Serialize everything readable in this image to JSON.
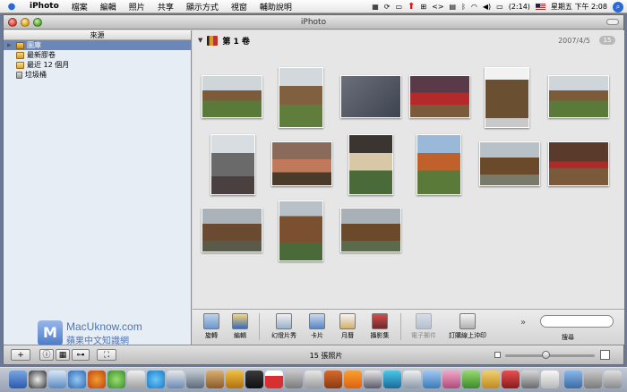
{
  "menubar": {
    "app_name": "iPhoto",
    "menus": [
      "檔案",
      "編輯",
      "照片",
      "共享",
      "顯示方式",
      "視窗",
      "輔助說明"
    ],
    "battery": "(2:14)",
    "clock": "星期五 下午 2:08"
  },
  "window": {
    "title": "iPhoto"
  },
  "sidebar": {
    "header": "來源",
    "items": [
      {
        "label": "圖庫",
        "selected": true
      },
      {
        "label": "最新膠卷",
        "selected": false
      },
      {
        "label": "最近 12 個月",
        "selected": false
      },
      {
        "label": "垃圾桶",
        "selected": false
      }
    ]
  },
  "watermark": {
    "logo_letter": "M",
    "line1": "MacUknow.com",
    "line2": "蘋果中文知識網"
  },
  "roll": {
    "title": "第 1 卷",
    "date": "2007/4/5",
    "count": "15"
  },
  "toolbar": {
    "rotate": "旋轉",
    "edit": "編輯",
    "slideshow": "幻燈片秀",
    "card": "卡片",
    "calendar": "月曆",
    "book": "攝影集",
    "email": "電子郵件",
    "order_prints": "訂購線上沖印",
    "search": "搜尋"
  },
  "status": {
    "photo_count": "15 張照片",
    "zoom_level": 0.45
  },
  "colors": {
    "selection": "#6b87b8",
    "accent": "#2a6ad8"
  }
}
